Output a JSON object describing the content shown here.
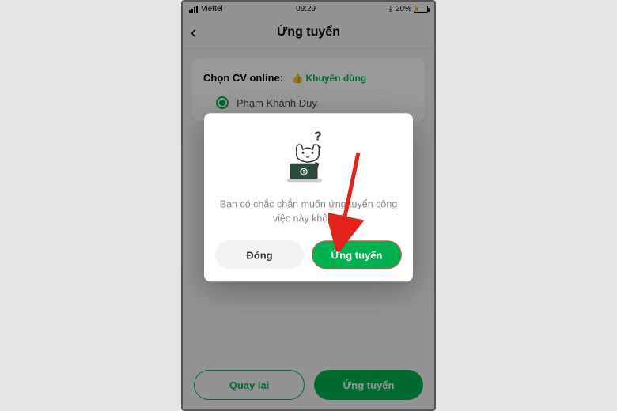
{
  "statusBar": {
    "carrier": "Viettel",
    "time": "09:29",
    "battery": "20%"
  },
  "header": {
    "title": "Ứng tuyển"
  },
  "cvSection": {
    "label": "Chọn CV online:",
    "recommendText": "Khuyên dùng",
    "selectedName": "Phạm Khánh Duy"
  },
  "bottomActions": {
    "back": "Quay lại",
    "apply": "Ứng tuyển"
  },
  "modal": {
    "message": "Bạn có chắc chắn muốn ứng tuyển công việc này không?",
    "closeLabel": "Đóng",
    "applyLabel": "Ứng tuyển"
  }
}
